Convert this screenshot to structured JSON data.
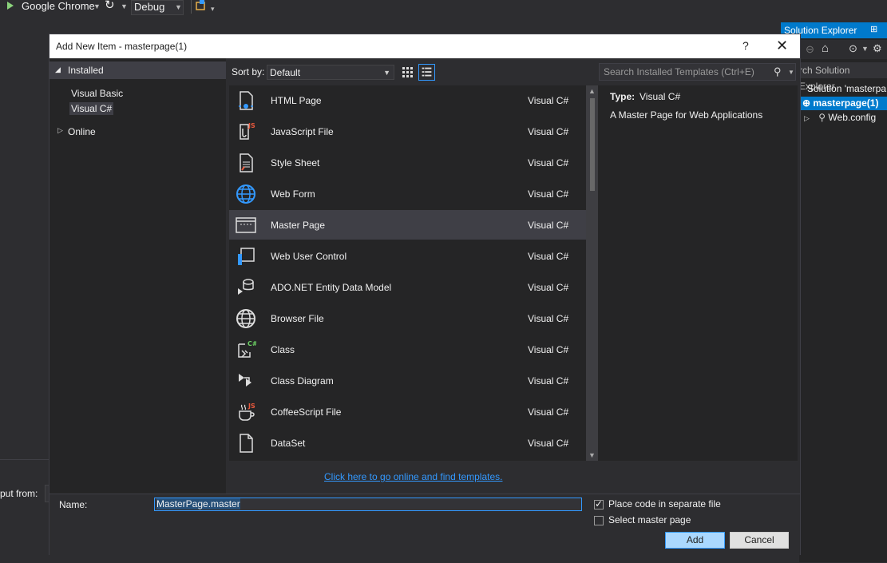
{
  "ide": {
    "browser_target": "Google Chrome",
    "config": "Debug",
    "output_from_label": "put from:"
  },
  "solution_explorer": {
    "title": "Solution Explorer",
    "search_placeholder": "rch Solution Explorer",
    "solution_label": "Solution 'masterpa",
    "project_label": "masterpage(1)",
    "webconfig_label": "Web.config"
  },
  "dialog": {
    "title": "Add New Item - masterpage(1)",
    "help": "?",
    "close": "✕",
    "tree": {
      "installed": "Installed",
      "visual_basic": "Visual Basic",
      "visual_csharp": "Visual C#",
      "online": "Online"
    },
    "sort_label": "Sort by:",
    "sort_value": "Default",
    "search_placeholder": "Search Installed Templates (Ctrl+E)",
    "templates": [
      {
        "name": "HTML Page",
        "category": "Visual C#",
        "icon": "html-page-icon"
      },
      {
        "name": "JavaScript File",
        "category": "Visual C#",
        "icon": "javascript-file-icon"
      },
      {
        "name": "Style Sheet",
        "category": "Visual C#",
        "icon": "style-sheet-icon"
      },
      {
        "name": "Web Form",
        "category": "Visual C#",
        "icon": "globe-icon"
      },
      {
        "name": "Master Page",
        "category": "Visual C#",
        "icon": "master-page-icon"
      },
      {
        "name": "Web User Control",
        "category": "Visual C#",
        "icon": "web-user-control-icon"
      },
      {
        "name": "ADO.NET Entity Data Model",
        "category": "Visual C#",
        "icon": "entity-data-model-icon"
      },
      {
        "name": "Browser File",
        "category": "Visual C#",
        "icon": "browser-file-icon"
      },
      {
        "name": "Class",
        "category": "Visual C#",
        "icon": "class-icon"
      },
      {
        "name": "Class Diagram",
        "category": "Visual C#",
        "icon": "class-diagram-icon"
      },
      {
        "name": "CoffeeScript File",
        "category": "Visual C#",
        "icon": "coffeescript-file-icon"
      },
      {
        "name": "DataSet",
        "category": "Visual C#",
        "icon": "dataset-icon"
      }
    ],
    "selected_index": 4,
    "detail": {
      "type_label": "Type:",
      "type_value": "Visual C#",
      "description": "A Master Page for Web Applications"
    },
    "online_link": "Click here to go online and find templates.",
    "name_label": "Name:",
    "name_value": "MasterPage.master",
    "place_code_label": "Place code in separate file",
    "place_code_checked": true,
    "select_master_label": "Select master page",
    "select_master_checked": false,
    "add_button": "Add",
    "cancel_button": "Cancel"
  },
  "colors": {
    "accent": "#007acc",
    "link": "#3399ff",
    "background": "#2d2d30",
    "panel": "#252526"
  }
}
